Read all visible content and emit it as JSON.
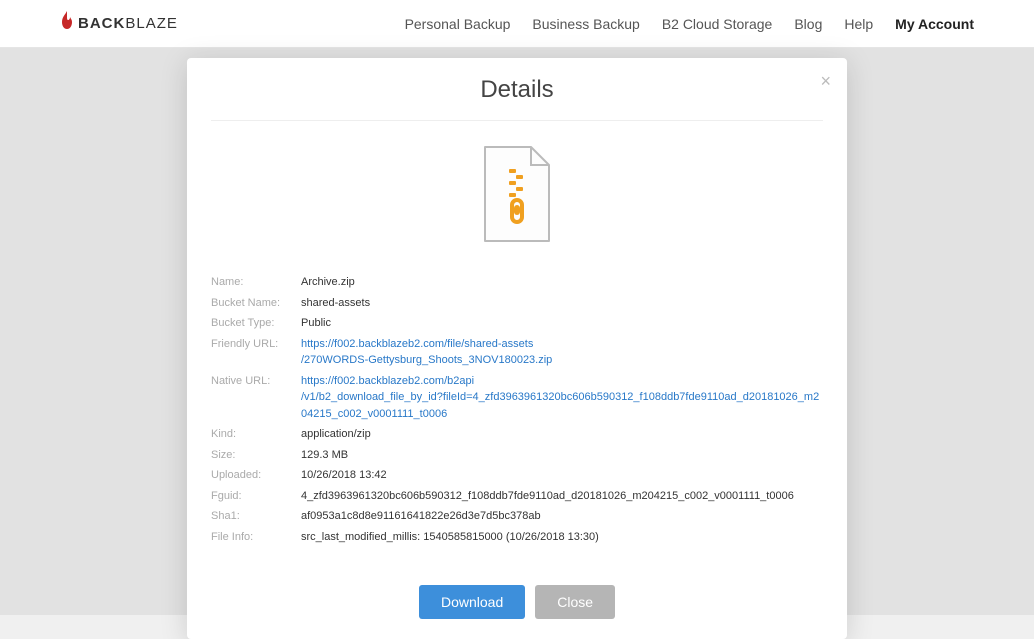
{
  "header": {
    "brand_back": "BACK",
    "brand_blaze": "BLAZE",
    "nav": {
      "personal": "Personal Backup",
      "business": "Business Backup",
      "b2": "B2 Cloud Storage",
      "blog": "Blog",
      "help": "Help",
      "account": "My Account"
    }
  },
  "modal": {
    "title": "Details",
    "labels": {
      "name": "Name:",
      "bucket_name": "Bucket Name:",
      "bucket_type": "Bucket Type:",
      "friendly_url": "Friendly URL:",
      "native_url": "Native URL:",
      "kind": "Kind:",
      "size": "Size:",
      "uploaded": "Uploaded:",
      "fguid": "Fguid:",
      "sha1": "Sha1:",
      "file_info": "File Info:"
    },
    "values": {
      "name": "Archive.zip",
      "bucket_name": "shared-assets",
      "bucket_type": "Public",
      "friendly_url_1": "https://f002.backblazeb2.com/file/shared-assets",
      "friendly_url_2": "/270WORDS-Gettysburg_Shoots_3NOV180023.zip",
      "native_url_1": "https://f002.backblazeb2.com/b2api",
      "native_url_2": "/v1/b2_download_file_by_id?fileId=4_zfd3963961320bc606b590312_f108ddb7fde9110ad_d20181026_m204215_c002_v0001111_t0006",
      "kind": "application/zip",
      "size": "129.3 MB",
      "uploaded": "10/26/2018 13:42",
      "fguid": "4_zfd3963961320bc606b590312_f108ddb7fde9110ad_d20181026_m204215_c002_v0001111_t0006",
      "sha1": "af0953a1c8d8e91161641822e26d3e7d5bc378ab",
      "file_info": "src_last_modified_millis: 1540585815000   (10/26/2018 13:30)"
    },
    "buttons": {
      "download": "Download",
      "close": "Close"
    }
  }
}
